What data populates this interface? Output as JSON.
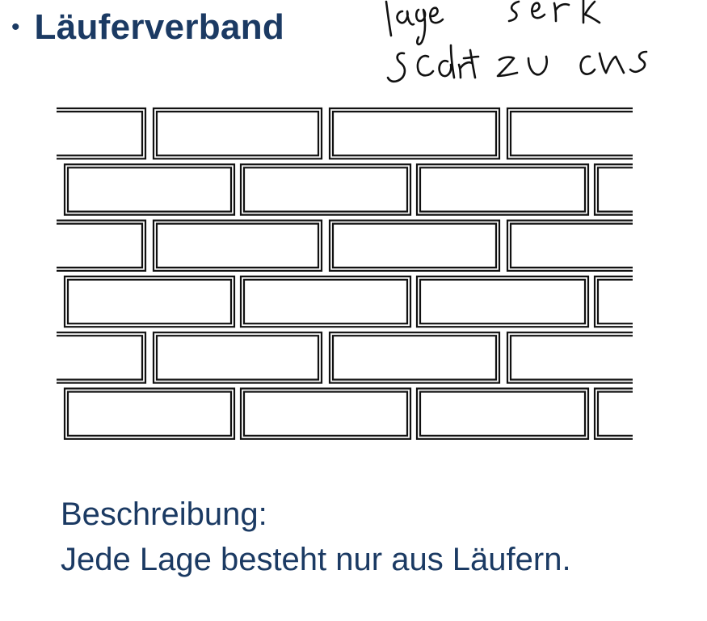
{
  "slide": {
    "bullet": "•",
    "title": "Läuferverband",
    "handwritten_note": [
      "Lange Stark",
      "sicht zu uns"
    ],
    "description_label": "Beschreibung:",
    "description_text": "Jede Lage besteht nur aus Läufern."
  },
  "diagram": {
    "type": "brick-wall",
    "bond": "Läuferverband",
    "courses": 6,
    "stroke_color": "#111111"
  }
}
